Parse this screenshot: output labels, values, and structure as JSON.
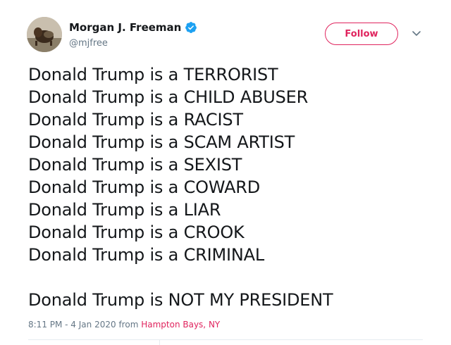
{
  "author": {
    "display_name": "Morgan J. Freeman",
    "handle": "@mjfree",
    "verified": true
  },
  "actions": {
    "follow_label": "Follow",
    "menu_icon": "chevron-down-icon"
  },
  "tweet": {
    "lines": [
      "Donald Trump is a TERRORIST",
      "Donald Trump is a CHILD ABUSER",
      "Donald Trump is a RACIST",
      "Donald Trump is a SCAM ARTIST",
      "Donald Trump is a SEXIST",
      "Donald Trump is a COWARD",
      "Donald Trump is a LIAR",
      "Donald Trump is a CROOK",
      "Donald Trump is a CRIMINAL"
    ],
    "closing_line": "Donald Trump is NOT MY PRESIDENT"
  },
  "meta": {
    "timestamp": "8:11 PM - 4 Jan 2020",
    "from_label": "from",
    "location": "Hampton Bays, NY"
  },
  "colors": {
    "accent": "#e0245e",
    "verified_blue": "#1da1f2",
    "text_primary": "#14171a",
    "text_secondary": "#657786"
  }
}
